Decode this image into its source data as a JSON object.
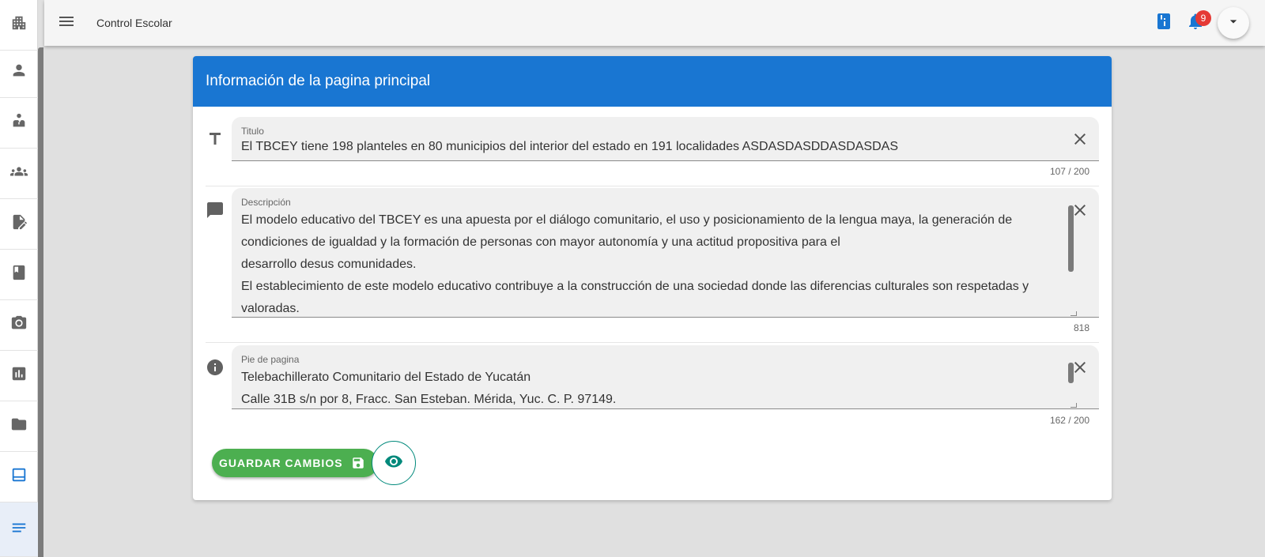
{
  "app": {
    "title": "Control Escolar"
  },
  "rail": {
    "items": [
      {
        "name": "apartment-icon"
      },
      {
        "name": "person-icon"
      },
      {
        "name": "supervisor-icon"
      },
      {
        "name": "groups-icon"
      },
      {
        "name": "edit-document-icon"
      },
      {
        "name": "book-icon"
      },
      {
        "name": "camera-icon"
      },
      {
        "name": "chart-icon"
      },
      {
        "name": "folder-icon"
      },
      {
        "name": "web-page-icon"
      },
      {
        "name": "notes-icon"
      }
    ]
  },
  "topbar": {
    "notification_count": "9"
  },
  "card": {
    "title": "Información de la pagina principal",
    "titulo": {
      "label": "Titulo",
      "value": "El TBCEY tiene 198 planteles en 80 municipios del interior del estado en 191 localidades ASDASDASDDASDASDAS",
      "counter": "107 / 200"
    },
    "descripcion": {
      "label": "Descripción",
      "lines": [
        "El modelo educativo del TBCEY es una apuesta por el diálogo comunitario, el uso y posicionamiento de la lengua maya, la generación de",
        "condiciones de igualdad y la formación de personas con mayor autonomía y una actitud propositiva para el",
        "desarrollo desus comunidades.",
        "El establecimiento de este modelo educativo contribuye a la construcción de una sociedad donde las diferencias culturales son respetadas y",
        "valoradas."
      ],
      "counter": "818"
    },
    "pie": {
      "label": "Pie de pagina",
      "lines": [
        "Telebachillerato Comunitario del Estado de Yucatán",
        "Calle 31B s/n por 8, Fracc. San Esteban. Mérida, Yuc. C. P. 97149."
      ],
      "counter": "162 / 200"
    },
    "save_label": "GUARDAR CAMBIOS"
  }
}
